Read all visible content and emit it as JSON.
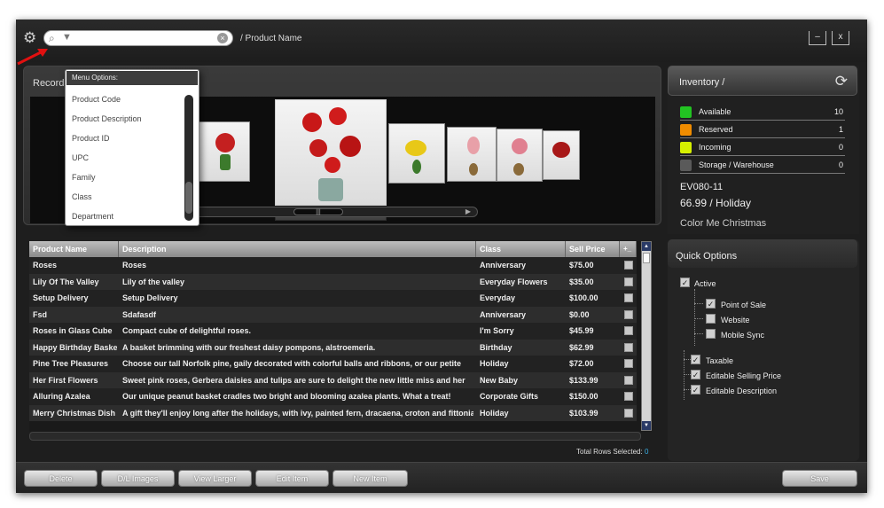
{
  "header": {
    "breadcrumb": "/ Product Name",
    "search_placeholder": "",
    "minimize_label": "–",
    "close_label": "x"
  },
  "records": {
    "label": "Records"
  },
  "dropdown": {
    "header": "Menu Options:",
    "items": [
      "Product Code",
      "Product Description",
      "Product ID",
      "UPC",
      "Family",
      "Class",
      "Department"
    ]
  },
  "table": {
    "columns": [
      "Product Name",
      "Description",
      "Class",
      "Sell Price",
      "+_"
    ],
    "rows": [
      {
        "name": "Roses",
        "desc": "Roses",
        "class": "Anniversary",
        "price": "$75.00"
      },
      {
        "name": "Lily Of The Valley",
        "desc": "Lily of the valley",
        "class": "Everyday Flowers",
        "price": "$35.00"
      },
      {
        "name": "Setup Delivery",
        "desc": "Setup Delivery",
        "class": "Everyday",
        "price": "$100.00"
      },
      {
        "name": "Fsd",
        "desc": "Sdafasdf",
        "class": "Anniversary",
        "price": "$0.00"
      },
      {
        "name": "Roses in Glass Cube",
        "desc": "Compact cube of delightful roses.",
        "class": "I'm Sorry",
        "price": "$45.99"
      },
      {
        "name": "Happy Birthday Basket",
        "desc": "A basket brimming with our freshest daisy pompons, alstroemeria.",
        "class": "Birthday",
        "price": "$62.99"
      },
      {
        "name": "Pine Tree Pleasures",
        "desc": "Choose our tall Norfolk pine, gaily decorated with colorful balls and ribbons, or our petite",
        "class": "Holiday",
        "price": "$72.00"
      },
      {
        "name": "Her First Flowers",
        "desc": "Sweet pink roses, Gerbera daisies and tulips are sure to delight the new little miss and her",
        "class": "New Baby",
        "price": "$133.99"
      },
      {
        "name": "Alluring Azalea",
        "desc": "Our unique peanut basket cradles two bright and blooming azalea plants. What a treat!",
        "class": "Corporate Gifts",
        "price": "$150.00"
      },
      {
        "name": "Merry Christmas Dish",
        "desc": "A gift they'll enjoy long after the holidays, with ivy, painted fern, dracaena, croton and fittonia",
        "class": "Holiday",
        "price": "$103.99"
      }
    ],
    "total_label": "Total Rows Selected:",
    "total_value": "0"
  },
  "inventory": {
    "title": "Inventory /",
    "rows": [
      {
        "label": "Available",
        "value": "10",
        "color": "#22c322"
      },
      {
        "label": "Reserved",
        "value": "1",
        "color": "#f08c00"
      },
      {
        "label": "Incoming",
        "value": "0",
        "color": "#d6f000"
      },
      {
        "label": "Storage / Warehouse",
        "value": "0",
        "color": "#5a5a5a"
      }
    ],
    "sku": "EV080-11",
    "price": "66.99 / Holiday",
    "product_name": "Color Me Christmas"
  },
  "quick_options": {
    "title": "Quick Options",
    "active": "Active",
    "point_of_sale": "Point of Sale",
    "website": "Website",
    "mobile_sync": "Mobile Sync",
    "taxable": "Taxable",
    "editable_price": "Editable Selling Price",
    "editable_desc": "Editable Description"
  },
  "buttons": {
    "delete": "Delete",
    "dl_images": "D/L Images",
    "view_larger": "View Larger",
    "edit_item": "Edit Item",
    "new_item": "New Item",
    "save": "Save"
  },
  "icons": [
    "gear-icon",
    "search-icon",
    "filter-icon",
    "clear-icon",
    "refresh-icon",
    "minimize-icon",
    "close-icon"
  ]
}
